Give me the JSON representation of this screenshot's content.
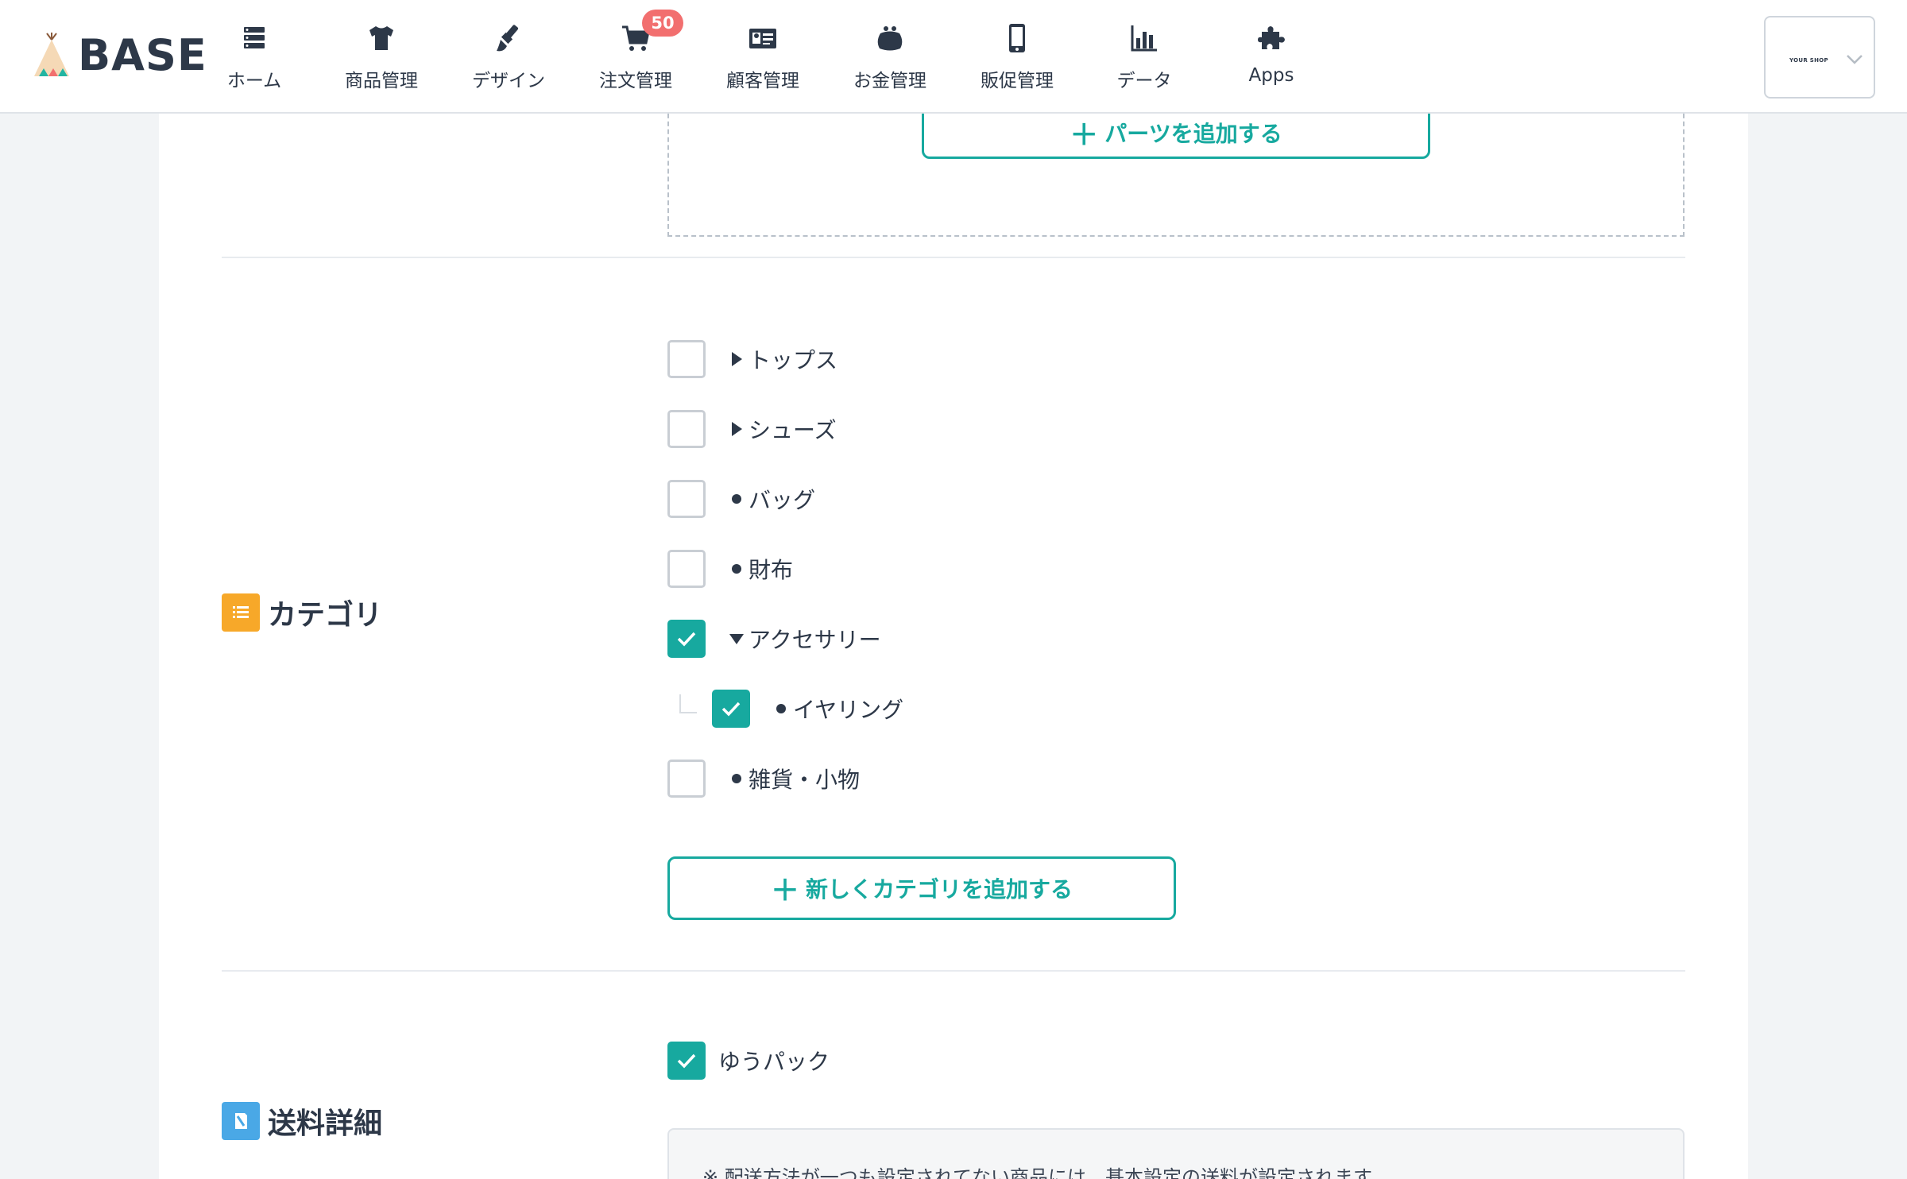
{
  "header": {
    "logo_text": "BASE",
    "nav": [
      {
        "label": "ホーム",
        "icon": "home-list-icon"
      },
      {
        "label": "商品管理",
        "icon": "tshirt-icon"
      },
      {
        "label": "デザイン",
        "icon": "paintbrush-icon"
      },
      {
        "label": "注文管理",
        "icon": "cart-icon",
        "badge": "50"
      },
      {
        "label": "顧客管理",
        "icon": "id-card-icon"
      },
      {
        "label": "お金管理",
        "icon": "wallet-icon"
      },
      {
        "label": "販促管理",
        "icon": "smartphone-icon"
      },
      {
        "label": "データ",
        "icon": "bar-chart-icon"
      },
      {
        "label": "Apps",
        "icon": "puzzle-icon"
      }
    ],
    "shop_name": "YOUR SHOP"
  },
  "parts": {
    "add_button_label": "パーツを追加する"
  },
  "category": {
    "title": "カテゴリ",
    "items": [
      {
        "label": "トップス",
        "checked": false,
        "marker": "triangle-right"
      },
      {
        "label": "シューズ",
        "checked": false,
        "marker": "triangle-right"
      },
      {
        "label": "バッグ",
        "checked": false,
        "marker": "bullet"
      },
      {
        "label": "財布",
        "checked": false,
        "marker": "bullet"
      },
      {
        "label": "アクセサリー",
        "checked": true,
        "marker": "triangle-down"
      },
      {
        "label": "イヤリング",
        "checked": true,
        "marker": "bullet",
        "child": true
      },
      {
        "label": "雑貨・小物",
        "checked": false,
        "marker": "bullet"
      }
    ],
    "add_button_label": "新しくカテゴリを追加する"
  },
  "shipping": {
    "title": "送料詳細",
    "option_label": "ゆうパック",
    "option_checked": true,
    "note": "※ 配送方法が一つも設定されてない商品には、基本設定の送料が設定されます"
  },
  "colors": {
    "accent": "#17a99f",
    "badge": "#f26f6f",
    "category_icon": "#f7a829",
    "shipping_icon": "#4aa8e6",
    "text": "#2d3848"
  }
}
